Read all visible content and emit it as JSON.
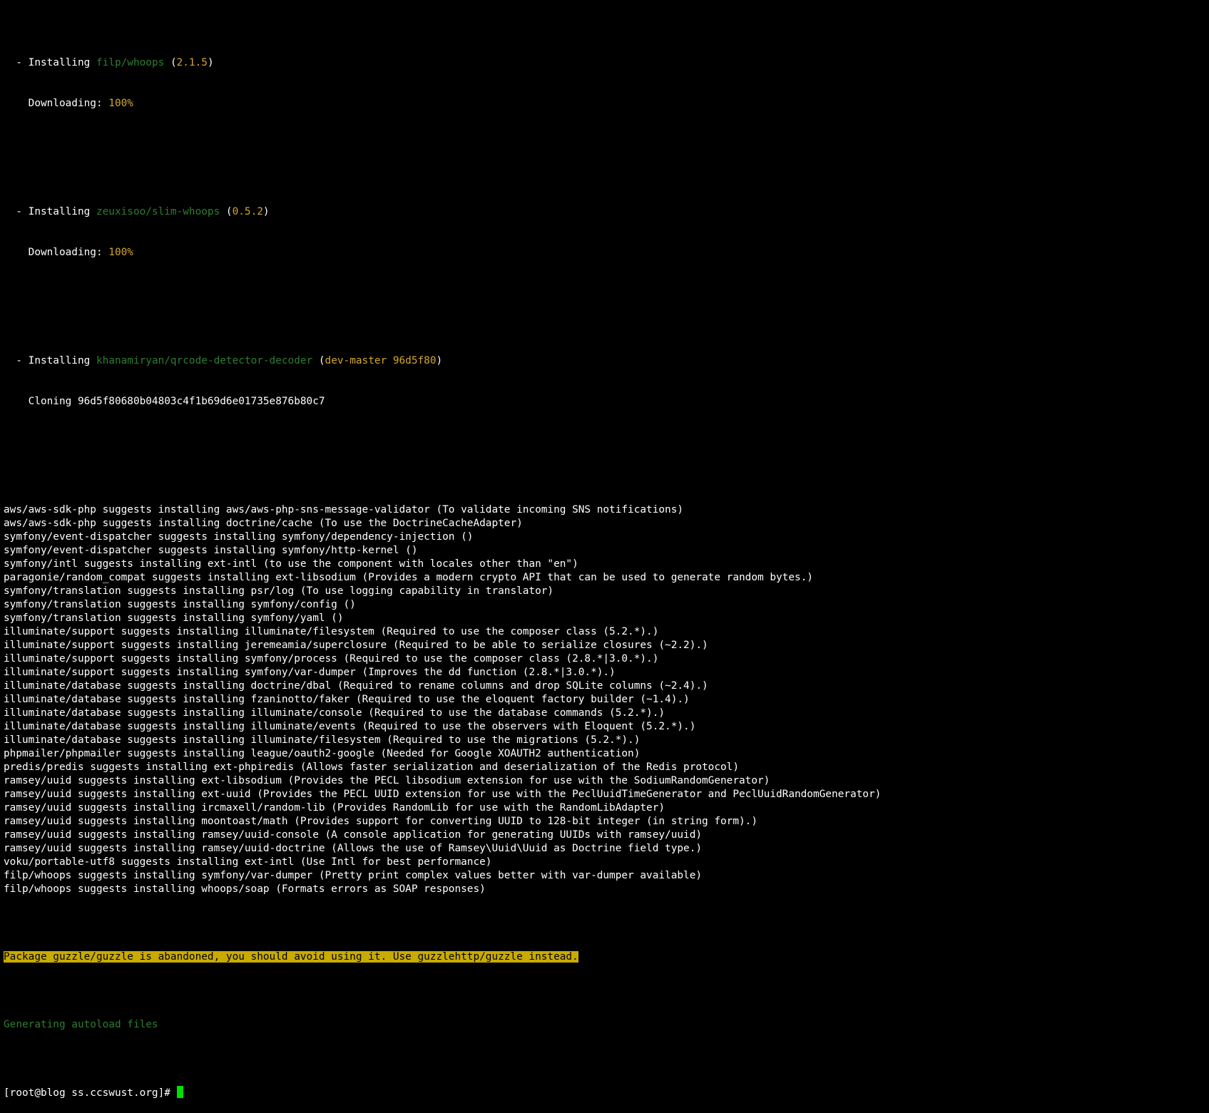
{
  "install_blocks": [
    {
      "prefix": "  - Installing ",
      "package": "filp/whoops",
      "version_open": " (",
      "version": "2.1.5",
      "version_close": ")",
      "detail": "    Downloading: ",
      "detail_value": "100%"
    },
    {
      "prefix": "  - Installing ",
      "package": "zeuxisoo/slim-whoops",
      "version_open": " (",
      "version": "0.5.2",
      "version_close": ")",
      "detail": "    Downloading: ",
      "detail_value": "100%"
    },
    {
      "prefix": "  - Installing ",
      "package": "khanamiryan/qrcode-detector-decoder",
      "version_open": " (",
      "version": "dev-master 96d5f80",
      "version_close": ")",
      "detail": "    Cloning 96d5f80680b04803c4f1b69d6e01735e876b80c7",
      "detail_value": ""
    }
  ],
  "suggestions": [
    "aws/aws-sdk-php suggests installing aws/aws-php-sns-message-validator (To validate incoming SNS notifications)",
    "aws/aws-sdk-php suggests installing doctrine/cache (To use the DoctrineCacheAdapter)",
    "symfony/event-dispatcher suggests installing symfony/dependency-injection ()",
    "symfony/event-dispatcher suggests installing symfony/http-kernel ()",
    "symfony/intl suggests installing ext-intl (to use the component with locales other than \"en\")",
    "paragonie/random_compat suggests installing ext-libsodium (Provides a modern crypto API that can be used to generate random bytes.)",
    "symfony/translation suggests installing psr/log (To use logging capability in translator)",
    "symfony/translation suggests installing symfony/config ()",
    "symfony/translation suggests installing symfony/yaml ()",
    "illuminate/support suggests installing illuminate/filesystem (Required to use the composer class (5.2.*).)",
    "illuminate/support suggests installing jeremeamia/superclosure (Required to be able to serialize closures (~2.2).)",
    "illuminate/support suggests installing symfony/process (Required to use the composer class (2.8.*|3.0.*).)",
    "illuminate/support suggests installing symfony/var-dumper (Improves the dd function (2.8.*|3.0.*).)",
    "illuminate/database suggests installing doctrine/dbal (Required to rename columns and drop SQLite columns (~2.4).)",
    "illuminate/database suggests installing fzaninotto/faker (Required to use the eloquent factory builder (~1.4).)",
    "illuminate/database suggests installing illuminate/console (Required to use the database commands (5.2.*).)",
    "illuminate/database suggests installing illuminate/events (Required to use the observers with Eloquent (5.2.*).)",
    "illuminate/database suggests installing illuminate/filesystem (Required to use the migrations (5.2.*).)",
    "phpmailer/phpmailer suggests installing league/oauth2-google (Needed for Google XOAUTH2 authentication)",
    "predis/predis suggests installing ext-phpiredis (Allows faster serialization and deserialization of the Redis protocol)",
    "ramsey/uuid suggests installing ext-libsodium (Provides the PECL libsodium extension for use with the SodiumRandomGenerator)",
    "ramsey/uuid suggests installing ext-uuid (Provides the PECL UUID extension for use with the PeclUuidTimeGenerator and PeclUuidRandomGenerator)",
    "ramsey/uuid suggests installing ircmaxell/random-lib (Provides RandomLib for use with the RandomLibAdapter)",
    "ramsey/uuid suggests installing moontoast/math (Provides support for converting UUID to 128-bit integer (in string form).)",
    "ramsey/uuid suggests installing ramsey/uuid-console (A console application for generating UUIDs with ramsey/uuid)",
    "ramsey/uuid suggests installing ramsey/uuid-doctrine (Allows the use of Ramsey\\Uuid\\Uuid as Doctrine field type.)",
    "voku/portable-utf8 suggests installing ext-intl (Use Intl for best performance)",
    "filp/whoops suggests installing symfony/var-dumper (Pretty print complex values better with var-dumper available)",
    "filp/whoops suggests installing whoops/soap (Formats errors as SOAP responses)"
  ],
  "warning": "Package guzzle/guzzle is abandoned, you should avoid using it. Use guzzlehttp/guzzle instead.",
  "autoload": "Generating autoload files",
  "prompt": "[root@blog ss.ccswust.org]# ",
  "colors": {
    "background": "#000000",
    "text": "#ffffff",
    "package": "#2e7d32",
    "version": "#d4a72c",
    "warning_bg": "#c9ab00",
    "cursor": "#00e000"
  }
}
